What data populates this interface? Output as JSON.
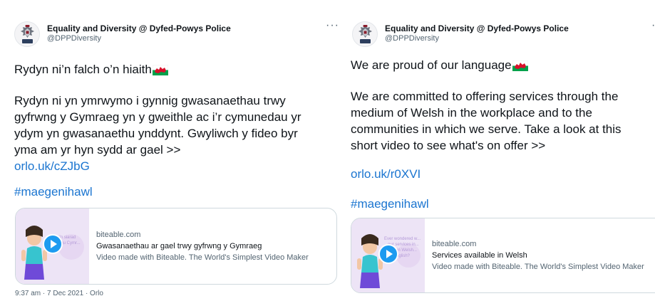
{
  "colors": {
    "link": "#1b75d0",
    "text": "#0f1419",
    "secondary": "#536471",
    "border": "#cfd9de",
    "thumb_bg": "#ede4f6"
  },
  "icons": {
    "avatar": "police-crest-icon",
    "more": "more-options-icon",
    "flag": "welsh-flag-icon",
    "play": "play-icon"
  },
  "tweet_cy": {
    "author": {
      "name": "Equality and Diversity @ Dyfed-Powys Police",
      "handle": "@DPPDiversity"
    },
    "more": "···",
    "headline": "Rydyn ni’n falch o’n hiaith",
    "body_lines": [
      "Rydyn ni yn ymrwymo i gynnig gwasanaethau trwy",
      "gyfrwng y Gymraeg  yn y gweithle ac i’r cymunedau yr",
      "ydym yn gwasanaethu ynddynt.  Gwyliwch y fideo byr",
      "yma am yr hyn sydd ar gael >>"
    ],
    "link": "orlo.uk/cZJbG",
    "hashtag": "#maegenihawl",
    "card": {
      "domain": "biteable.com",
      "title": "Gwasanaethau ar gael trwy gyfrwng y Gymraeg",
      "description": "Video made with Biteable. The World's Simplest Video Maker",
      "thumb_text": [
        "...h chi'n siarad",
        "...n dysgu Cymr..."
      ]
    },
    "footer": "9:37 am · 7 Dec 2021 · Orlo"
  },
  "tweet_en": {
    "author": {
      "name": "Equality and Diversity @ Dyfed-Powys Police",
      "handle": "@DPPDiversity"
    },
    "more": "···",
    "headline": "We are proud of our language",
    "body_lines": [
      "We are committed to offering services through the",
      "medium of Welsh in the workplace and to the",
      "communities in which we serve.  Take a look at this",
      "short video to see what's on offer >>"
    ],
    "link": "orlo.uk/r0XVI",
    "hashtag": "#maegenihawl",
    "card": {
      "domain": "biteable.com",
      "title": "Services available in Welsh",
      "description": "Video made with Biteable. The World's Simplest Video Maker",
      "thumb_text": [
        "Ever wondered w...",
        "...our services in...",
        "...able in Welsh...",
        "...as English?"
      ]
    }
  }
}
